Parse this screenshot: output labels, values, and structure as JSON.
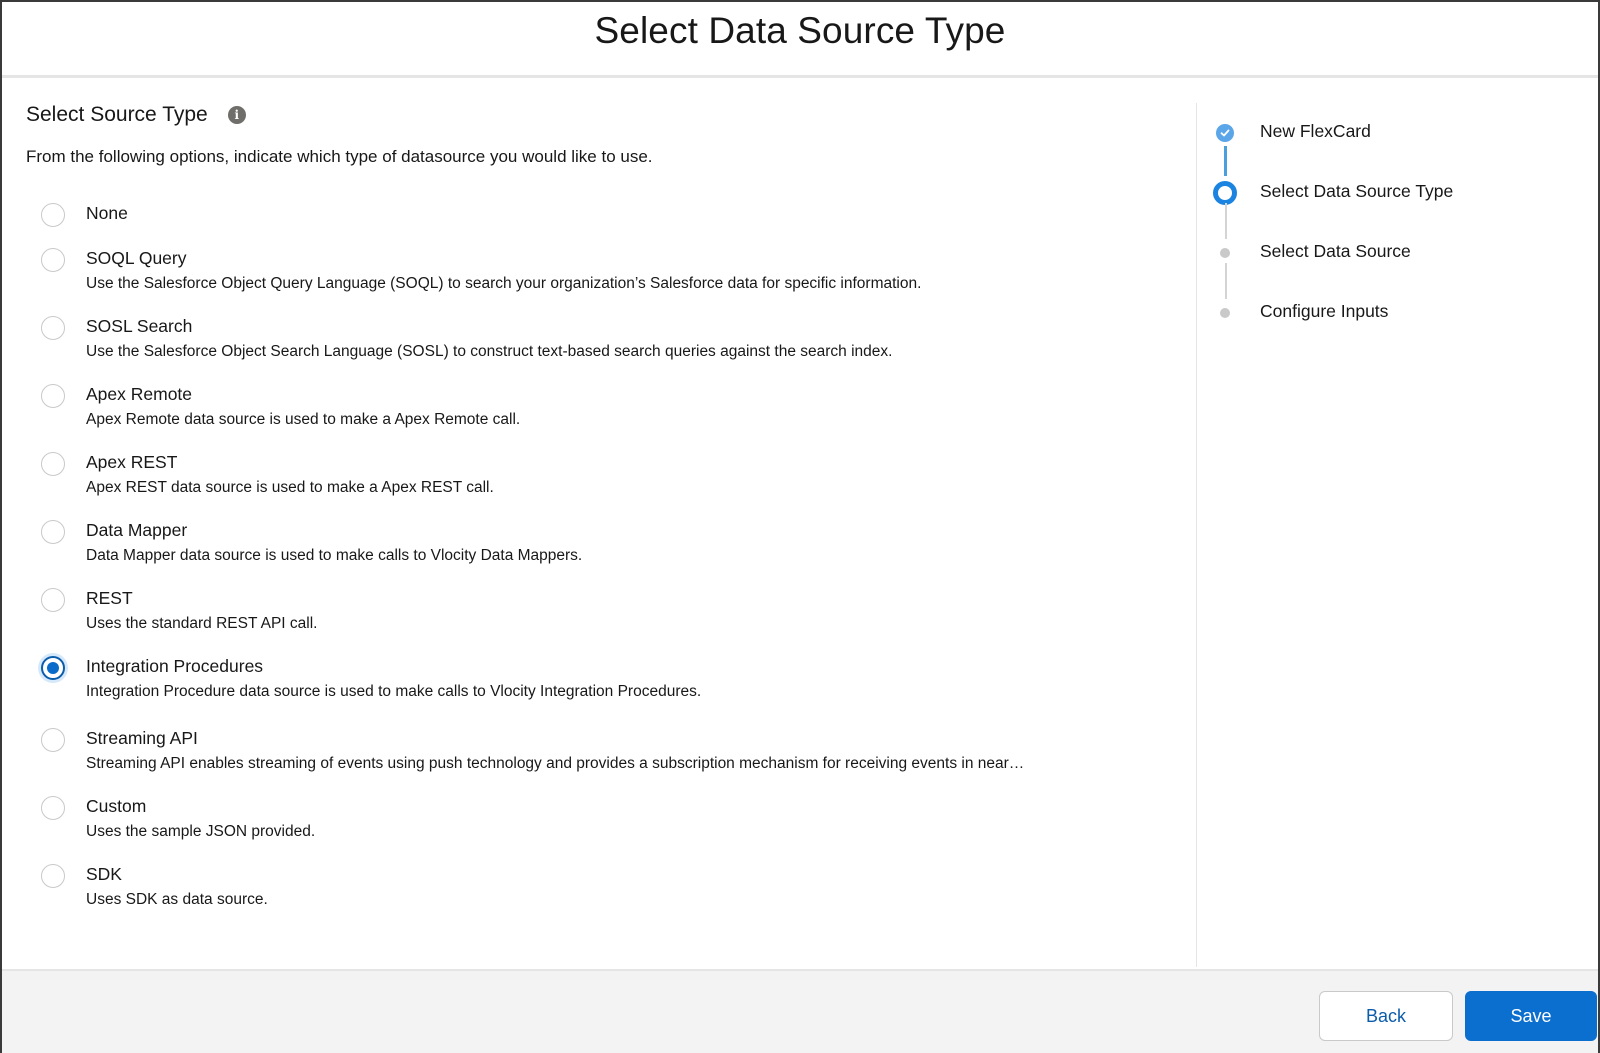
{
  "modal": {
    "title": "Select Data Source Type"
  },
  "section": {
    "title": "Select Source Type",
    "info_icon": "info-icon",
    "description": "From the following options, indicate which type of datasource you would like to use."
  },
  "options": [
    {
      "label": "None",
      "description": "",
      "selected": false
    },
    {
      "label": "SOQL Query",
      "description": "Use the Salesforce Object Query Language (SOQL) to search your organization’s Salesforce data for specific information.",
      "selected": false
    },
    {
      "label": "SOSL Search",
      "description": "Use the Salesforce Object Search Language (SOSL) to construct text-based search queries against the search index.",
      "selected": false
    },
    {
      "label": "Apex Remote",
      "description": "Apex Remote data source is used to make a Apex Remote call.",
      "selected": false
    },
    {
      "label": "Apex REST",
      "description": "Apex REST data source is used to make a Apex REST call.",
      "selected": false
    },
    {
      "label": "Data Mapper",
      "description": "Data Mapper data source is used to make calls to Vlocity Data Mappers.",
      "selected": false
    },
    {
      "label": "REST",
      "description": "Uses the standard REST API call.",
      "selected": false
    },
    {
      "label": "Integration Procedures",
      "description": "Integration Procedure data source is used to make calls to Vlocity Integration Procedures.",
      "selected": true
    },
    {
      "label": "Streaming API",
      "description": "Streaming API enables streaming of events using push technology and provides a subscription mechanism for receiving events in near…",
      "selected": false
    },
    {
      "label": "Custom",
      "description": "Uses the sample JSON provided.",
      "selected": false
    },
    {
      "label": "SDK",
      "description": "Uses SDK as data source.",
      "selected": false
    }
  ],
  "steps": [
    {
      "label": "New FlexCard",
      "status": "complete"
    },
    {
      "label": "Select Data Source Type",
      "status": "current"
    },
    {
      "label": "Select Data Source",
      "status": "pending"
    },
    {
      "label": "Configure Inputs",
      "status": "pending"
    }
  ],
  "footer": {
    "back_label": "Back",
    "save_label": "Save"
  },
  "colors": {
    "brand": "#0b6fcf",
    "step_complete": "#5aa6e8",
    "step_current": "#1b84e0",
    "step_pending": "#c9c9c9"
  }
}
